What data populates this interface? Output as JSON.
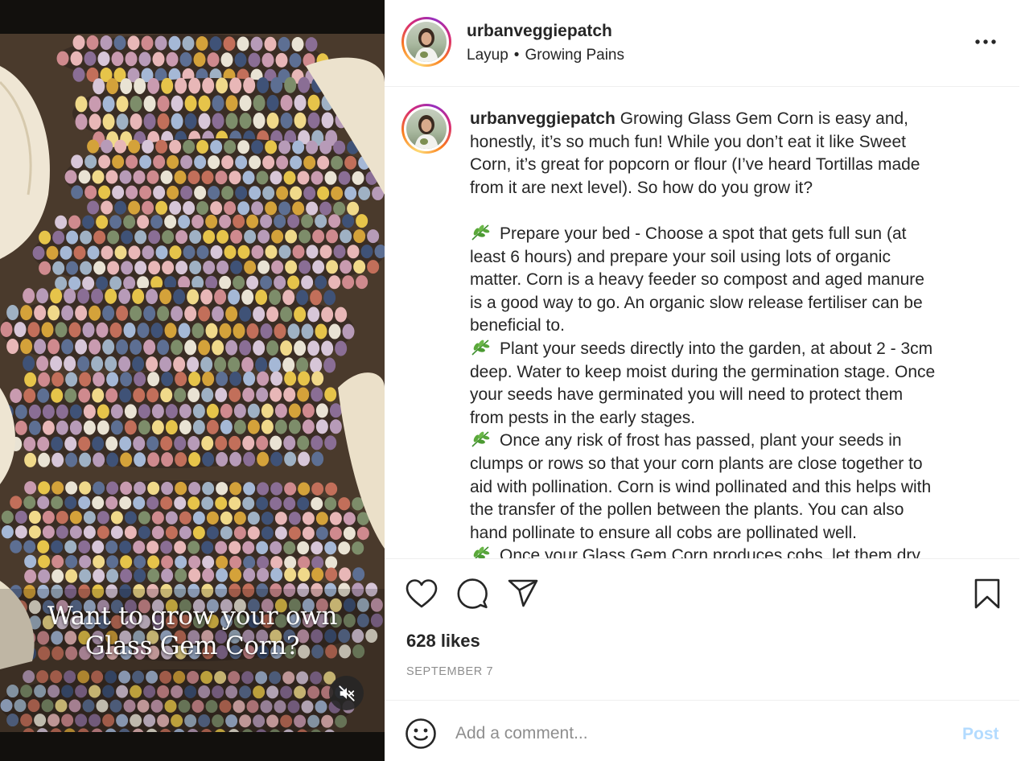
{
  "media": {
    "caption_lines": [
      "Want to grow your own",
      "Glass Gem Corn?"
    ],
    "mute_icon": "speaker-muted-icon"
  },
  "post": {
    "username": "urbanveggiepatch",
    "audio_artist": "Layup",
    "audio_separator": "•",
    "audio_title": "Growing Pains",
    "more_icon": "more-options-icon"
  },
  "caption": {
    "username": "urbanveggiepatch",
    "intro_lines": [
      "Growing Glass Gem Corn is easy and,",
      "honestly, it’s so much fun! While you don’t eat it like Sweet",
      "Corn, it’s great for popcorn or flour (I’ve heard Tortillas made",
      "from it are next level). So how do you grow it?"
    ],
    "bullet_icon": "herb-leaf-icon",
    "steps": [
      [
        "Prepare your bed - Choose a spot that gets full sun (at",
        "least 6 hours) and prepare your soil using lots of organic",
        "matter. Corn is a heavy feeder so compost and aged manure",
        "is a good way to go. An organic slow release fertiliser can be",
        "beneficial to."
      ],
      [
        "Plant your seeds directly into the garden, at about 2 - 3cm",
        "deep. Water to keep moist during the germination stage. Once",
        "your seeds have germinated you will need to protect them",
        "from pests in the early stages."
      ],
      [
        "Once any risk of frost has passed, plant your seeds in",
        "clumps or rows so that your corn plants are close together to",
        "aid with pollination. Corn is wind pollinated and this helps with",
        "the transfer of the pollen between the plants. You can also",
        "hand pollinate to ensure all cobs are pollinated well."
      ],
      [
        "Once your Glass Gem Corn produces cobs, let them dry"
      ]
    ]
  },
  "actions": {
    "like_icon": "heart-icon",
    "comment_icon": "comment-bubble-icon",
    "share_icon": "paper-plane-icon",
    "save_icon": "bookmark-icon",
    "likes_text": "628 likes",
    "date_text": "SEPTEMBER 7"
  },
  "comment": {
    "emoji_icon": "smiley-icon",
    "placeholder": "Add a comment...",
    "post_label": "Post"
  },
  "colors": {
    "text": "#262626",
    "secondary": "#8e8e8e",
    "post_disabled": "#b3dbff",
    "divider": "#efefef"
  }
}
